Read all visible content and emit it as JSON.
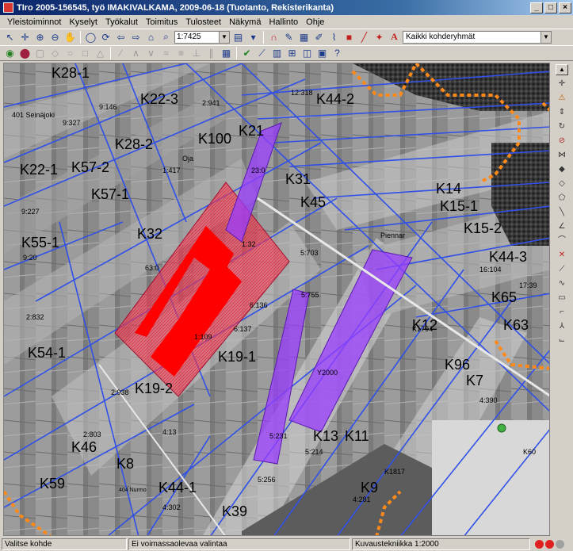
{
  "window": {
    "title": "TIro 2005-156545, työ IMAKIVALKAMA, 2009-06-18 (Tuotanto, Rekisterikanta)"
  },
  "menu": [
    "Yleistoiminnot",
    "Kyselyt",
    "Työkalut",
    "Toimitus",
    "Tulosteet",
    "Näkymä",
    "Hallinto",
    "Ohje"
  ],
  "toolbar": {
    "scale_value": "1:7425",
    "group_value": "Kaikki kohderyhmät"
  },
  "map": {
    "labels": [
      {
        "text": "K28-1",
        "cls": "big"
      },
      {
        "text": "K22-3",
        "cls": "big"
      },
      {
        "text": "K44-2",
        "cls": "big"
      },
      {
        "text": "K100",
        "cls": "big"
      },
      {
        "text": "K21",
        "cls": "big"
      },
      {
        "text": "K28-2",
        "cls": "big"
      },
      {
        "text": "K22-1",
        "cls": "big"
      },
      {
        "text": "K57-2",
        "cls": "big"
      },
      {
        "text": "K57-1",
        "cls": "big"
      },
      {
        "text": "K31",
        "cls": "big"
      },
      {
        "text": "K45",
        "cls": "big"
      },
      {
        "text": "K14",
        "cls": "big"
      },
      {
        "text": "K15-1",
        "cls": "big"
      },
      {
        "text": "K15-2",
        "cls": "big"
      },
      {
        "text": "K32",
        "cls": "big"
      },
      {
        "text": "K55-1",
        "cls": "big"
      },
      {
        "text": "K44-3",
        "cls": "big"
      },
      {
        "text": "K65",
        "cls": "big"
      },
      {
        "text": "K12",
        "cls": "big"
      },
      {
        "text": "K63",
        "cls": "big"
      },
      {
        "text": "K54-1",
        "cls": "big"
      },
      {
        "text": "K19-1",
        "cls": "big"
      },
      {
        "text": "K96",
        "cls": "big"
      },
      {
        "text": "K19-2",
        "cls": "big"
      },
      {
        "text": "K7",
        "cls": "big"
      },
      {
        "text": "K13",
        "cls": "big"
      },
      {
        "text": "K11",
        "cls": "big"
      },
      {
        "text": "K46",
        "cls": "big"
      },
      {
        "text": "K8",
        "cls": "big"
      },
      {
        "text": "K59",
        "cls": "big"
      },
      {
        "text": "K44-1",
        "cls": "big"
      },
      {
        "text": "K39",
        "cls": "big"
      },
      {
        "text": "K9",
        "cls": "big"
      },
      {
        "text": "401 Seinäjoki",
        "cls": "small"
      },
      {
        "text": "404 Nurmo",
        "cls": "tiny"
      },
      {
        "text": "Oja",
        "cls": "small"
      },
      {
        "text": "Piennar",
        "cls": "small"
      },
      {
        "text": "2:941",
        "cls": "small"
      },
      {
        "text": "9:146",
        "cls": "small"
      },
      {
        "text": "9:327",
        "cls": "small"
      },
      {
        "text": "9:227",
        "cls": "small"
      },
      {
        "text": "9:20",
        "cls": "small"
      },
      {
        "text": "2:832",
        "cls": "small"
      },
      {
        "text": "1:417",
        "cls": "small"
      },
      {
        "text": "23:0",
        "cls": "small"
      },
      {
        "text": "63:0",
        "cls": "small"
      },
      {
        "text": "1:32",
        "cls": "small"
      },
      {
        "text": "1:109",
        "cls": "small"
      },
      {
        "text": "6:136",
        "cls": "small"
      },
      {
        "text": "6:137",
        "cls": "small"
      },
      {
        "text": "5:703",
        "cls": "small"
      },
      {
        "text": "5:755",
        "cls": "small"
      },
      {
        "text": "12:318",
        "cls": "small"
      },
      {
        "text": "2:938",
        "cls": "small"
      },
      {
        "text": "2:803",
        "cls": "small"
      },
      {
        "text": "5:231",
        "cls": "small"
      },
      {
        "text": "5:214",
        "cls": "small"
      },
      {
        "text": "5:256",
        "cls": "small"
      },
      {
        "text": "4:302",
        "cls": "small"
      },
      {
        "text": "4:390",
        "cls": "small"
      },
      {
        "text": "4:13",
        "cls": "small"
      },
      {
        "text": "4:281",
        "cls": "small"
      },
      {
        "text": "16:104",
        "cls": "small"
      },
      {
        "text": "17:39",
        "cls": "small"
      },
      {
        "text": "Y2000",
        "cls": "small"
      },
      {
        "text": "K1817",
        "cls": "small"
      },
      {
        "text": "K1794",
        "cls": "small"
      },
      {
        "text": "K60",
        "cls": "small"
      }
    ]
  },
  "status": {
    "left": "Valitse kohde",
    "middle": "Ei voimassaolevaa valintaa",
    "right": "Kuvaustekniikka 1:2000"
  },
  "colors": {
    "highlight_red": "#ff0000",
    "highlight_purple": "#9a3cff",
    "boundary_blue": "#3050e8",
    "boundary_orange": "#ff8a1a"
  }
}
